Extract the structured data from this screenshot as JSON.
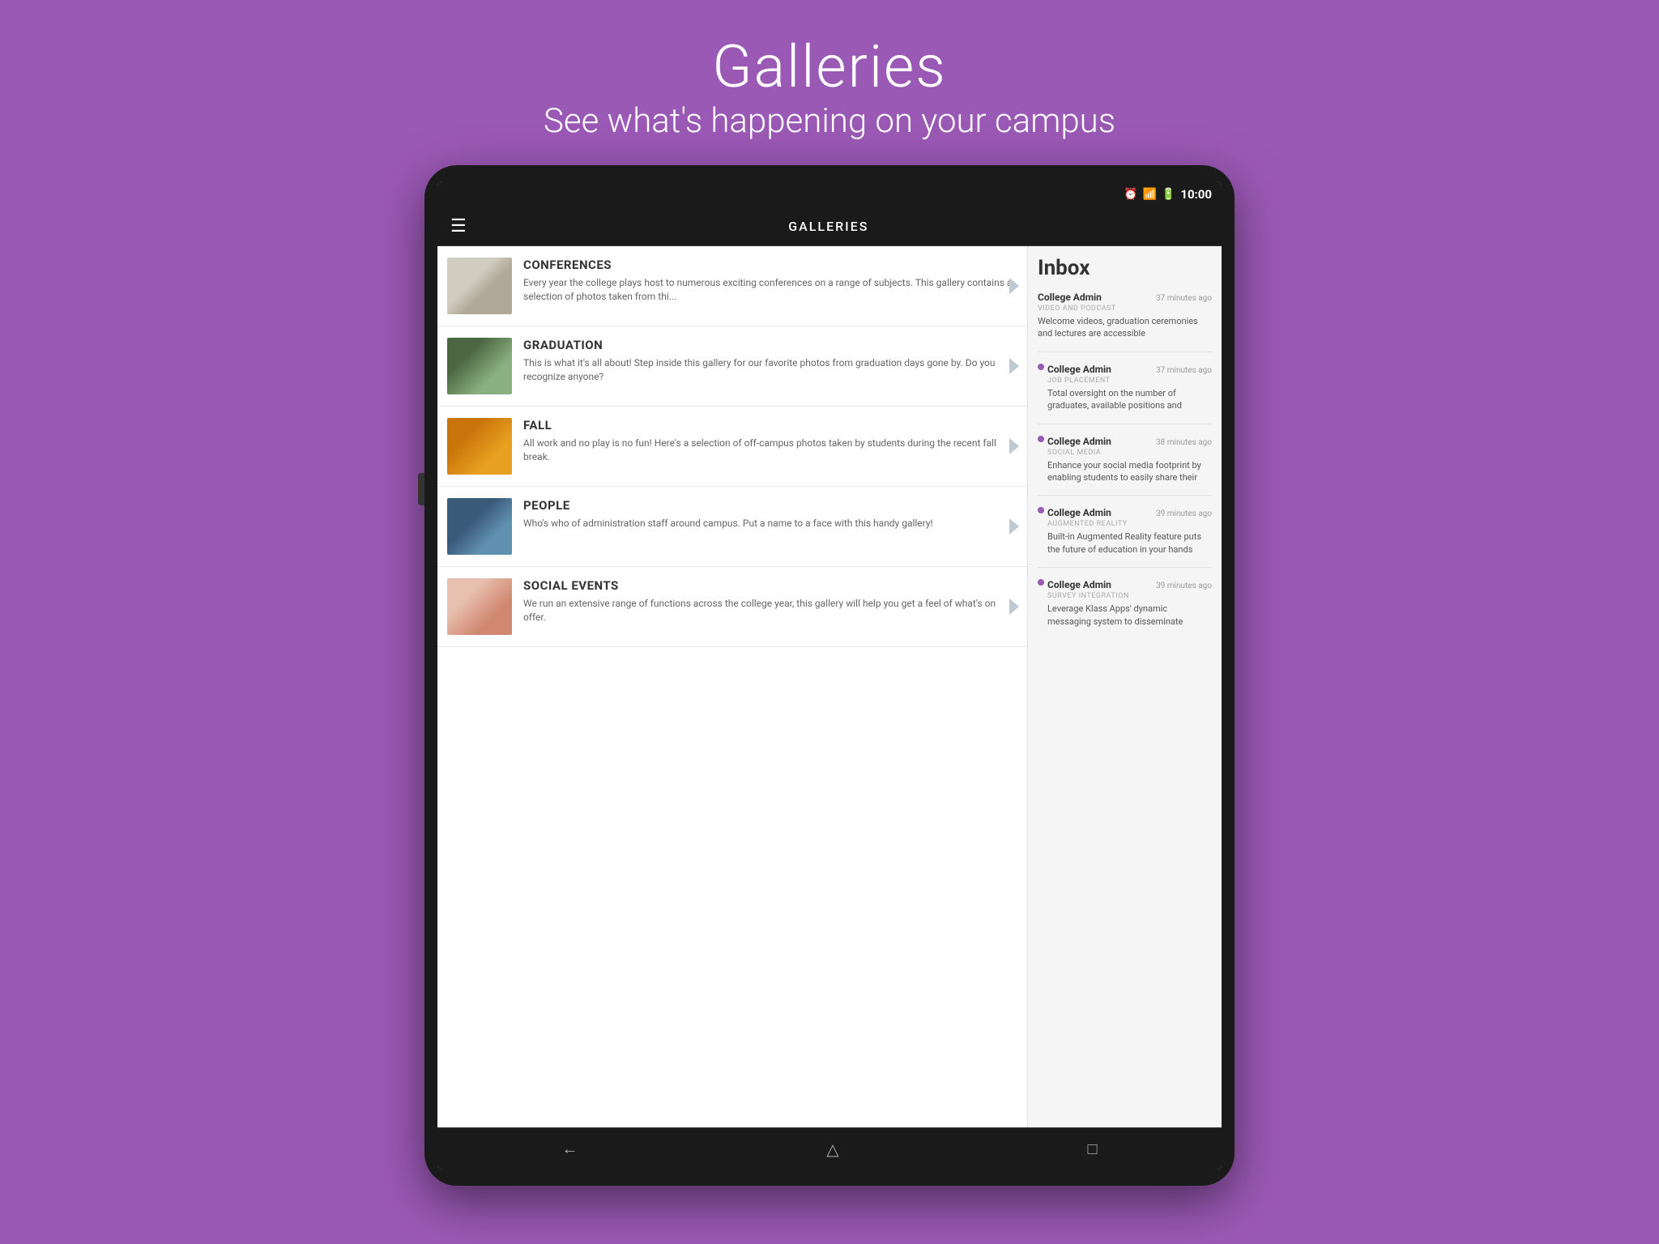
{
  "page": {
    "title": "Galleries",
    "subtitle": "See what's happening on your campus"
  },
  "status_bar": {
    "time": "10:00"
  },
  "app_bar": {
    "title": "GALLERIES"
  },
  "gallery_items": [
    {
      "id": "conferences",
      "title": "CONFERENCES",
      "description": "Every year the college plays host to numerous exciting conferences on a range of subjects.  This gallery contains a selection of photos taken from thi...",
      "thumb_class": "thumb-conferences"
    },
    {
      "id": "graduation",
      "title": "GRADUATION",
      "description": "This is what it's all about!  Step inside this gallery for our favorite photos from graduation days gone by.  Do you recognize anyone?",
      "thumb_class": "thumb-graduation"
    },
    {
      "id": "fall",
      "title": "FALL",
      "description": "All work and no play is no fun!  Here's a selection of off-campus photos taken by students during the recent fall break.",
      "thumb_class": "thumb-fall"
    },
    {
      "id": "people",
      "title": "PEOPLE",
      "description": "Who's who of administration staff around campus.  Put a name to a face with this handy gallery!",
      "thumb_class": "thumb-people"
    },
    {
      "id": "social-events",
      "title": "SOCIAL EVENTS",
      "description": "We run an extensive range of functions across the college year, this gallery will help you get a feel of what's on offer.",
      "thumb_class": "thumb-social"
    }
  ],
  "inbox": {
    "title": "Inbox",
    "items": [
      {
        "sender": "College Admin",
        "time": "37 minutes ago",
        "category": "VIDEO AND PODCAST",
        "preview": "Welcome videos, graduation ceremonies and lectures are accessible",
        "unread": false
      },
      {
        "sender": "College Admin",
        "time": "37 minutes ago",
        "category": "JOB PLACEMENT",
        "preview": "Total oversight on the number of graduates, available positions and",
        "unread": true
      },
      {
        "sender": "College Admin",
        "time": "38 minutes ago",
        "category": "SOCIAL MEDIA",
        "preview": "Enhance your social media footprint by enabling students to easily share their",
        "unread": true
      },
      {
        "sender": "College Admin",
        "time": "39 minutes ago",
        "category": "AUGMENTED REALITY",
        "preview": "Built-in Augmented Reality feature puts the future of education in your hands",
        "unread": true
      },
      {
        "sender": "College Admin",
        "time": "39 minutes ago",
        "category": "SURVEY INTEGRATION",
        "preview": "Leverage Klass Apps' dynamic messaging system to disseminate",
        "unread": true
      }
    ]
  }
}
